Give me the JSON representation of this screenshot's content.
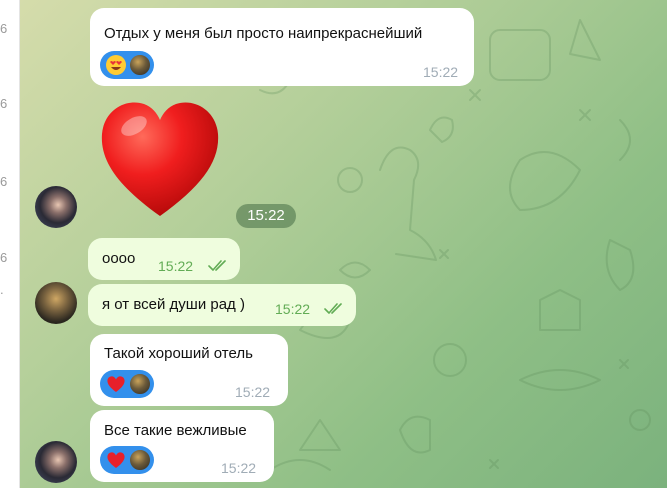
{
  "sidebar": {
    "digits": [
      "6",
      "6",
      "6",
      "6",
      "."
    ]
  },
  "messages": [
    {
      "text": "Отдых у меня был просто наипрекраснейший",
      "time": "15:22",
      "reaction": "heart-eyes-face"
    },
    {
      "sticker": "red-heart",
      "time": "15:22"
    },
    {
      "text": "оооо",
      "time": "15:22",
      "outgoing": true,
      "status": "read"
    },
    {
      "text": "я от всей души рад )",
      "time": "15:22",
      "outgoing": true,
      "status": "read"
    },
    {
      "text": "Такой хороший отель",
      "time": "15:22",
      "reaction": "red-heart"
    },
    {
      "text": "Все такие вежливые",
      "time": "15:22",
      "reaction": "red-heart"
    }
  ],
  "colors": {
    "reaction_bg": "#3390ec",
    "outgoing_bg": "#effdde",
    "incoming_bg": "#ffffff",
    "read_check": "#62ac55"
  }
}
